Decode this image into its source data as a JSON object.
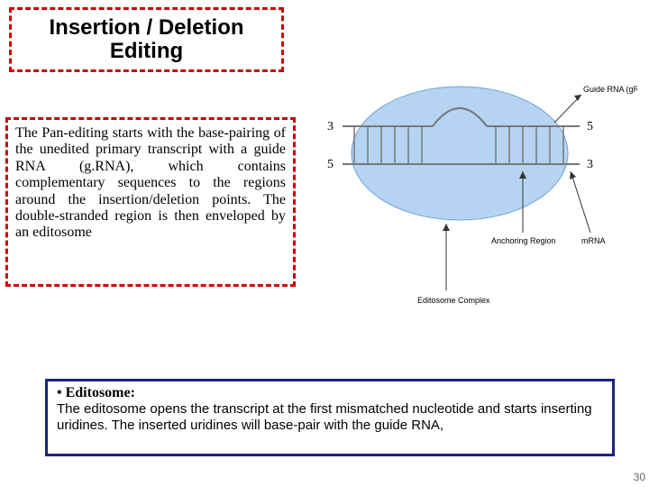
{
  "title": "Insertion / Deletion Editing",
  "paragraph": "The Pan-editing starts with the base-pairing of the unedited primary transcript with a guide RNA (g.RNA), which contains complementary sequences to the regions around the insertion/deletion points. The double-stranded region is then enveloped by an editosome",
  "bottom": {
    "heading_bullet": "•",
    "heading": "Editosome:",
    "body": "The editosome opens the transcript at the first mismatched nucleotide and starts inserting uridines. The inserted uridines will base-pair with the guide RNA,"
  },
  "diagram_labels": {
    "top_strand_left": "3",
    "top_strand_right": "5",
    "bottom_strand_left": "5",
    "bottom_strand_right": "3",
    "top_right_caption": "Guide RNA (gRNA)",
    "mid_right_caption": "mRNA",
    "mid_left_caption": "Anchoring Region",
    "bottom_caption": "Editosome Complex"
  },
  "page_number": "30"
}
